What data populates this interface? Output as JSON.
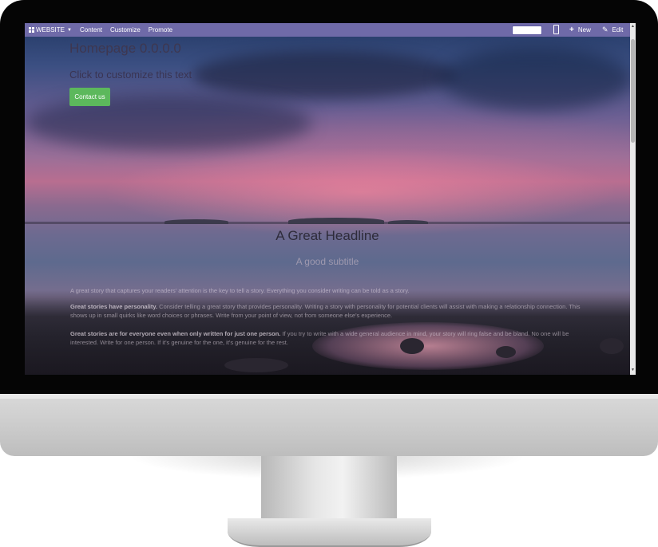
{
  "topbar": {
    "app_label": "WEBSITE",
    "menu": [
      "Content",
      "Customize",
      "Promote"
    ],
    "new_label": "New",
    "edit_label": "Edit",
    "color": "#6f6aa8"
  },
  "hero": {
    "title": "Homepage 0.0.0.0",
    "subtitle": "Click to customize this text",
    "cta_label": "Contact us",
    "cta_color": "#5cb85c"
  },
  "section": {
    "headline": "A Great Headline",
    "subheadline": "A good subtitle",
    "paragraphs": [
      {
        "bold": "",
        "text": "A great story that captures your readers' attention is the key to tell a story. Everything you consider writing can be told as a story."
      },
      {
        "bold": "Great stories have personality.",
        "text": " Consider telling a great story that provides personality. Writing a story with personality for potential clients will assist with making a relationship connection. This shows up in small quirks like word choices or phrases. Write from your point of view, not from someone else's experience."
      },
      {
        "bold": "Great stories are for everyone even when only written for just one person.",
        "text": " If you try to write with a wide general audience in mind, your story will ring false and be bland. No one will be interested. Write for one person. If it's genuine for the one, it's genuine for the rest."
      }
    ]
  }
}
